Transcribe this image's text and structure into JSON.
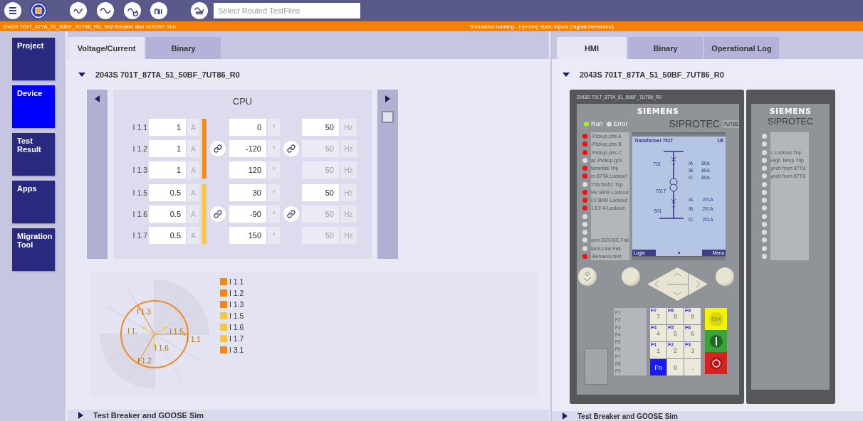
{
  "toolbar": {
    "search": {
      "placeholder": "Select Routed TestFiles"
    }
  },
  "status_bar": {
    "left": "2043S 701T_87TA_51_50BF_7UT86_R0, Test Breaker and GOOSE Sim",
    "right": "Simulation running - Injecting static inputs (Signal Generator)"
  },
  "sidebar": {
    "items": [
      {
        "label": "Project",
        "selected": false
      },
      {
        "label": "Device",
        "selected": true
      },
      {
        "label": "Test Result",
        "selected": false
      },
      {
        "label": "Apps",
        "selected": false
      },
      {
        "label": "Migration Tool",
        "selected": false
      }
    ]
  },
  "left_panel": {
    "tabs": [
      {
        "label": "Voltage/Current",
        "selected": true
      },
      {
        "label": "Binary",
        "selected": false
      }
    ],
    "sections": [
      {
        "title": "2043S 701T_87TA_51_50BF_7UT86_R0",
        "expanded": true
      },
      {
        "title": "Test Breaker and GOOSE Sim",
        "expanded": false
      }
    ],
    "card": {
      "title": "CPU",
      "checked": false,
      "groups": [
        {
          "color": "#f7870f",
          "phase_linked": true,
          "freq_linked": true,
          "rows": [
            {
              "label": "I 1.1",
              "amplitude": "1",
              "amplitude_unit": "A",
              "phase": "0",
              "phase_unit": "°",
              "frequency": "50",
              "frequency_unit": "Hz",
              "frequency_disabled": false
            },
            {
              "label": "I 1.2",
              "amplitude": "1",
              "amplitude_unit": "A",
              "phase": "-120",
              "phase_unit": "°",
              "frequency": "50",
              "frequency_unit": "Hz",
              "frequency_disabled": true
            },
            {
              "label": "I 1.3",
              "amplitude": "1",
              "amplitude_unit": "A",
              "phase": "120",
              "phase_unit": "°",
              "frequency": "50",
              "frequency_unit": "Hz",
              "frequency_disabled": true
            }
          ]
        },
        {
          "color": "#fbc637",
          "phase_linked": true,
          "freq_linked": true,
          "rows": [
            {
              "label": "I 1.5",
              "amplitude": "0.5",
              "amplitude_unit": "A",
              "phase": "30",
              "phase_unit": "°",
              "frequency": "50",
              "frequency_unit": "Hz",
              "frequency_disabled": false
            },
            {
              "label": "I 1.6",
              "amplitude": "0.5",
              "amplitude_unit": "A",
              "phase": "-90",
              "phase_unit": "°",
              "frequency": "50",
              "frequency_unit": "Hz",
              "frequency_disabled": true
            },
            {
              "label": "I 1.7",
              "amplitude": "0.5",
              "amplitude_unit": "A",
              "phase": "150",
              "phase_unit": "°",
              "frequency": "50",
              "frequency_unit": "Hz",
              "frequency_disabled": true
            }
          ]
        }
      ]
    },
    "phasor_diagram": {
      "arrow_labels": [
        "I 1.3",
        "I 1.",
        "I 1.5",
        "I 1.1",
        "I 1.6",
        "I 1.2"
      ],
      "legend": [
        {
          "label": "I 1.1",
          "color": "#f7870f"
        },
        {
          "label": "I 1.2",
          "color": "#f7870f"
        },
        {
          "label": "I 1.3",
          "color": "#f7870f"
        },
        {
          "label": "I 1.5",
          "color": "#fbc637"
        },
        {
          "label": "I 1.6",
          "color": "#fbc637"
        },
        {
          "label": "I 1.7",
          "color": "#fbc637"
        },
        {
          "label": "I 3.1",
          "color": "#f7870f"
        }
      ]
    }
  },
  "right_panel": {
    "tabs": [
      {
        "label": "HMI",
        "selected": true
      },
      {
        "label": "Binary",
        "selected": false
      },
      {
        "label": "Operational Log",
        "selected": false
      }
    ],
    "sections": [
      {
        "title": "2043S 701T_87TA_51_50BF_7UT86_R0",
        "expanded": true
      },
      {
        "title": "Test Breaker and GOOSE Sim",
        "expanded": false
      }
    ],
    "device": {
      "title": "2043S 701T_87TA_51_50BF_7UT86_R0",
      "brand": "SIEMENS",
      "model": "SIPROTEC",
      "model_tag": "7UT86",
      "status_leds": [
        {
          "label": "Run",
          "on": true
        },
        {
          "label": "Error",
          "on": false
        }
      ],
      "leds": [
        {
          "label": ".Pickup.phs A",
          "on": true
        },
        {
          "label": ".Pickup.phs B",
          "on": true
        },
        {
          "label": ".Pickup.phs C",
          "on": true
        },
        {
          "label": "at..Pickup.grd",
          "on": false
        },
        {
          "label": "ferential Trip",
          "on": true
        },
        {
          "label": "rn.87TA Lockout",
          "on": true
        },
        {
          "label": "7TA 50/51 Trip",
          "on": false
        },
        {
          "label": "HV BKR Lockout",
          "on": true
        },
        {
          "label": "LV BKR Lockout",
          "on": true
        },
        {
          "label": "1 EF A Lockout",
          "on": true
        },
        {
          "on": false
        },
        {
          "on": false
        },
        {
          "on": false
        },
        {
          "label": "arm.GOOSE Fail",
          "on": false
        },
        {
          "label": "larm.Link Fail",
          "on": false
        },
        {
          "label": ".Behavior.test",
          "on": true
        }
      ],
      "screen": {
        "title": "Transformer 701T",
        "page": "1/6",
        "nodes": [
          "701",
          "701T",
          "501"
        ],
        "measurements": [
          {
            "name": "IA",
            "value": "80A"
          },
          {
            "name": "IB",
            "value": "80A"
          },
          {
            "name": "IC",
            "value": "80A"
          },
          {
            "name": "IA",
            "value": "201A"
          },
          {
            "name": "IB",
            "value": "201A"
          },
          {
            "name": "IC",
            "value": "201A"
          }
        ],
        "softkeys": [
          "Login",
          "Menu"
        ]
      },
      "function_key_labels": [
        "F1",
        "F2",
        "F3",
        "F4",
        "F5",
        "F6",
        "F7",
        "F8",
        "F9"
      ],
      "keypad": [
        {
          "kind": "digit",
          "label": "7",
          "fn": "F7"
        },
        {
          "kind": "digit",
          "label": "8",
          "fn": "F8"
        },
        {
          "kind": "digit",
          "label": "9",
          "fn": "F9"
        },
        {
          "kind": "digit",
          "label": "4",
          "fn": "F4"
        },
        {
          "kind": "digit",
          "label": "5",
          "fn": "F5"
        },
        {
          "kind": "digit",
          "label": "6",
          "fn": "F6"
        },
        {
          "kind": "digit",
          "label": "1",
          "fn": "F1"
        },
        {
          "kind": "digit",
          "label": "2",
          "fn": "F2"
        },
        {
          "kind": "digit",
          "label": "3",
          "fn": "F3"
        },
        {
          "kind": "fn",
          "label": "Fn"
        },
        {
          "kind": "digit",
          "label": "0"
        },
        {
          "kind": "digit",
          "label": "."
        }
      ],
      "control_keys": [
        {
          "kind": "ctrl",
          "label": "Ctrl"
        },
        {
          "kind": "on"
        },
        {
          "kind": "off"
        }
      ]
    },
    "expansion_unit": {
      "brand": "SIEMENS",
      "model": "SIPROTEC",
      "leds": [
        {
          "on": false
        },
        {
          "on": false
        },
        {
          "label": "c Lockout Trip",
          "on": false
        },
        {
          "label": "High Temp Trip",
          "on": false
        },
        {
          "label": "ynch from 87TB",
          "on": false
        },
        {
          "label": "ynch from 87TB",
          "on": false
        },
        {
          "on": false
        },
        {
          "on": false
        },
        {
          "on": false
        },
        {
          "on": false
        },
        {
          "on": false
        },
        {
          "on": false
        },
        {
          "on": false
        },
        {
          "on": false
        },
        {
          "on": false
        },
        {
          "on": false
        }
      ]
    }
  }
}
